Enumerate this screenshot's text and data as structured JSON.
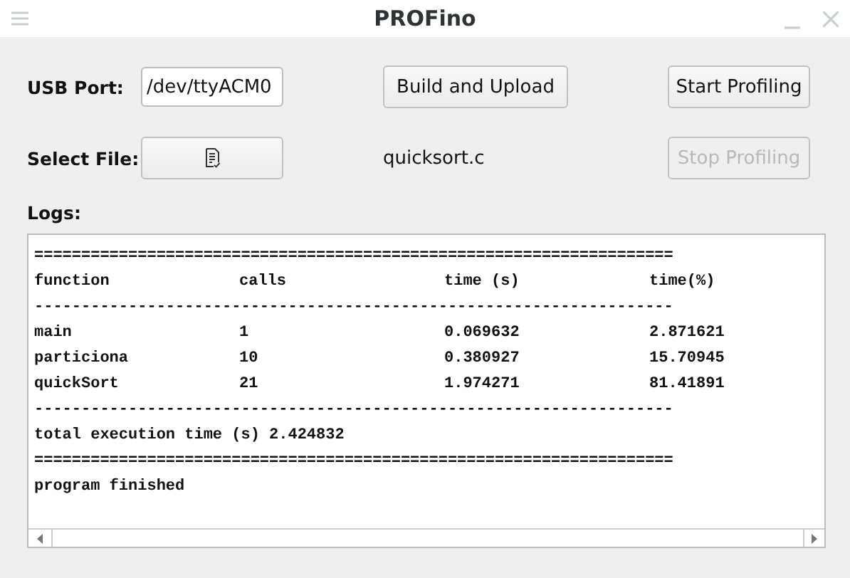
{
  "window": {
    "title": "PROFino"
  },
  "usb_port": {
    "label": "USB Port:",
    "value": "/dev/ttyACM0"
  },
  "build_button": {
    "label": "Build and Upload"
  },
  "start_button": {
    "label": "Start Profiling",
    "disabled": false
  },
  "select_file": {
    "label": "Select File:",
    "filename": "quicksort.c"
  },
  "stop_button": {
    "label": "Stop Profiling",
    "disabled": true
  },
  "logs": {
    "label": "Logs:",
    "lines": [
      {
        "kind": "rule",
        "text": "===================================================================="
      },
      {
        "kind": "row",
        "cells": [
          "function",
          "calls",
          "time (s)",
          "time(%)"
        ]
      },
      {
        "kind": "rule",
        "text": "--------------------------------------------------------------------"
      },
      {
        "kind": "row",
        "cells": [
          "main",
          "1",
          "0.069632",
          "2.871621"
        ]
      },
      {
        "kind": "row",
        "cells": [
          "particiona",
          "10",
          "0.380927",
          "15.70945"
        ]
      },
      {
        "kind": "row",
        "cells": [
          "quickSort",
          "21",
          "1.974271",
          "81.41891"
        ]
      },
      {
        "kind": "rule",
        "text": "--------------------------------------------------------------------"
      },
      {
        "kind": "text",
        "text": "total execution time (s) 2.424832"
      },
      {
        "kind": "rule",
        "text": "===================================================================="
      },
      {
        "kind": "text",
        "text": "program finished"
      }
    ]
  }
}
